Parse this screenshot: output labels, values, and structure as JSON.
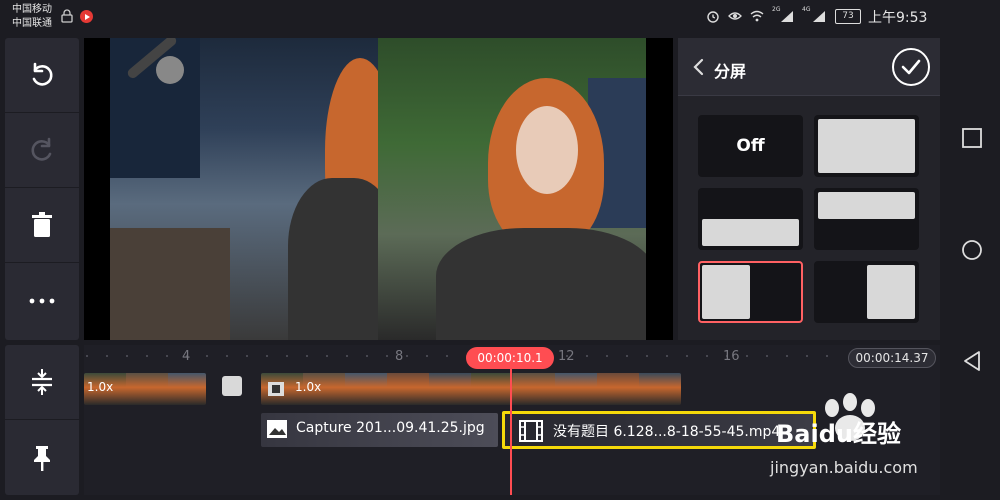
{
  "status_bar": {
    "carrier_1": "中国移动",
    "carrier_2": "中国联通",
    "signal_2g": "2G",
    "signal_4g": "4G",
    "battery": "73",
    "time": "上午9:53"
  },
  "preview": {
    "mode": "split-screen-left"
  },
  "split_panel": {
    "title": "分屏",
    "options": [
      {
        "id": "off",
        "label": "Off"
      },
      {
        "id": "full"
      },
      {
        "id": "bottom"
      },
      {
        "id": "top"
      },
      {
        "id": "left",
        "selected": true
      },
      {
        "id": "right"
      }
    ]
  },
  "timeline": {
    "current_time": "00:00:10.1",
    "total_time": "00:00:14.37",
    "ruler_labels": [
      "4",
      "8",
      "12",
      "16"
    ],
    "main_track": {
      "clip_1_speed": "1.0x",
      "clip_2_speed": "1.0x"
    },
    "layers": [
      {
        "name": "Capture 201...09.41.25.jpg",
        "icon": "image-icon"
      },
      {
        "name": "没有题目 6.128...8-18-55-45.mp4",
        "icon": "film-icon",
        "selected": true
      }
    ]
  },
  "watermark": {
    "brand": "Baidu经验",
    "url": "jingyan.baidu.com"
  },
  "colors": {
    "accent_red": "#ff4d52",
    "selection_yellow": "#f5d90a",
    "selected_option_border": "#ff6163"
  }
}
